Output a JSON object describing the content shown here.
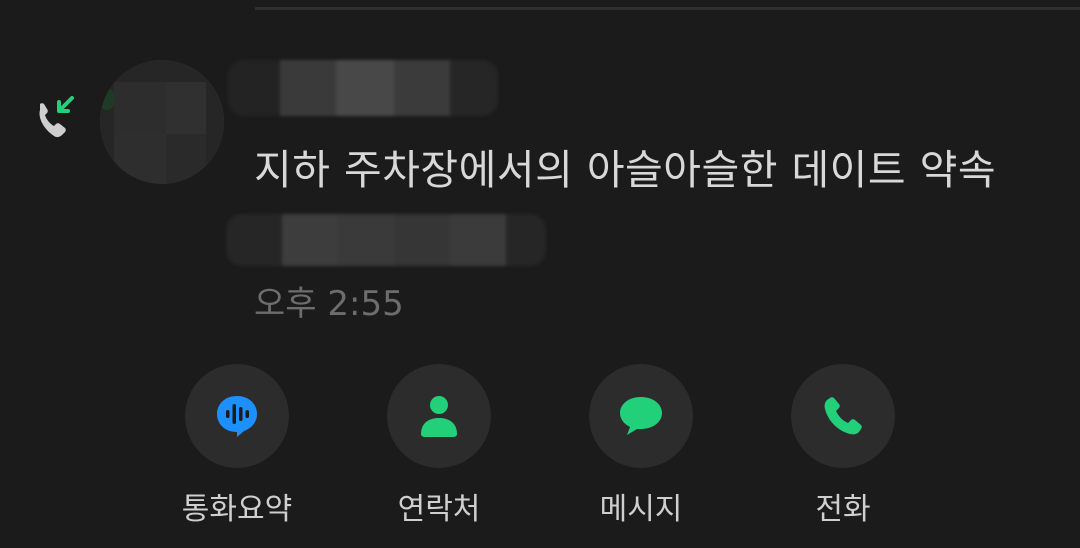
{
  "call_log": {
    "direction": "incoming",
    "title": "지하 주차장에서의 아슬아슬한 데이트 약속",
    "time": "오후 2:55",
    "contact_name_redacted": true,
    "contact_number_redacted": true
  },
  "actions": [
    {
      "label": "통화요약",
      "icon": "call-summary-icon",
      "color": "#1e8fff"
    },
    {
      "label": "연락처",
      "icon": "contact-person-icon",
      "color": "#22d07a"
    },
    {
      "label": "메시지",
      "icon": "message-bubble-icon",
      "color": "#22d07a"
    },
    {
      "label": "전화",
      "icon": "phone-icon",
      "color": "#22d07a"
    }
  ],
  "colors": {
    "background": "#1b1b1b",
    "accent_green": "#22d07a",
    "accent_blue": "#1e8fff",
    "button_bg": "#2c2c2c"
  }
}
